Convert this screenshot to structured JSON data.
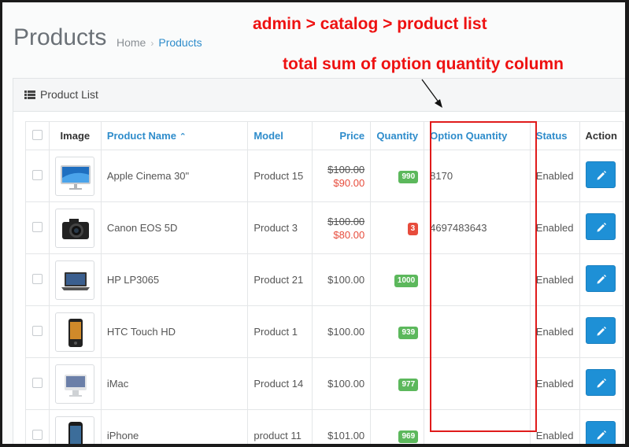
{
  "header": {
    "title": "Products",
    "breadcrumb": [
      {
        "label": "Home",
        "link": false
      },
      {
        "label": "Products",
        "link": true
      }
    ],
    "breadcrumb_separator": "›"
  },
  "annotations": {
    "path_note": "admin > catalog > product list",
    "column_note": "total sum of option quantity column",
    "color": "#ee1111"
  },
  "panel": {
    "title": "Product List",
    "icon": "list-icon"
  },
  "table": {
    "columns": {
      "image": "Image",
      "name": "Product Name",
      "model": "Model",
      "price": "Price",
      "quantity": "Quantity",
      "option_quantity": "Option Quantity",
      "status": "Status",
      "action": "Action"
    },
    "sort_indicator": "⌃",
    "rows": [
      {
        "thumb": "monitor",
        "name": "Apple Cinema 30\"",
        "model": "Product 15",
        "price": "$100.00",
        "special": "$90.00",
        "quantity": "990",
        "qty_color": "green",
        "option_quantity": "8170",
        "status": "Enabled"
      },
      {
        "thumb": "camera",
        "name": "Canon EOS 5D",
        "model": "Product 3",
        "price": "$100.00",
        "special": "$80.00",
        "quantity": "3",
        "qty_color": "red",
        "option_quantity": "4697483643",
        "status": "Enabled"
      },
      {
        "thumb": "laptop",
        "name": "HP LP3065",
        "model": "Product 21",
        "price": "$100.00",
        "special": "",
        "quantity": "1000",
        "qty_color": "green",
        "option_quantity": "",
        "status": "Enabled"
      },
      {
        "thumb": "phone",
        "name": "HTC Touch HD",
        "model": "Product 1",
        "price": "$100.00",
        "special": "",
        "quantity": "939",
        "qty_color": "green",
        "option_quantity": "",
        "status": "Enabled"
      },
      {
        "thumb": "imac",
        "name": "iMac",
        "model": "Product 14",
        "price": "$100.00",
        "special": "",
        "quantity": "977",
        "qty_color": "green",
        "option_quantity": "",
        "status": "Enabled"
      },
      {
        "thumb": "iphone",
        "name": "iPhone",
        "model": "product 11",
        "price": "$101.00",
        "special": "",
        "quantity": "969",
        "qty_color": "green",
        "option_quantity": "",
        "status": "Enabled"
      }
    ]
  },
  "colors": {
    "link": "#2e8ccb",
    "badge_green": "#5cb85c",
    "badge_red": "#e74c3c",
    "edit_button": "#1e90d6",
    "highlight_border": "#e01b1b"
  }
}
